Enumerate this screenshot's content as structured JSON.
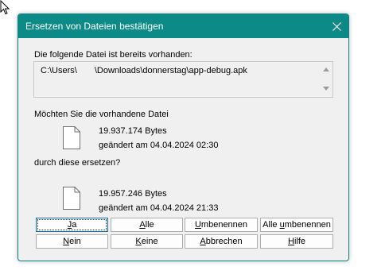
{
  "dialog": {
    "title": "Ersetzen von Dateien bestätigen",
    "info_label": "Die folgende Datei ist bereits vorhanden:",
    "path_prefix": "C:\\Users\\",
    "path_suffix": "\\Downloads\\donnerstag\\app-debug.apk",
    "existing_question": "Möchten Sie die vorhandene Datei",
    "existing_file": {
      "size": "19.937.174 Bytes",
      "changed": "geändert am 04.04.2024 02:30"
    },
    "replace_question": "durch diese ersetzen?",
    "new_file": {
      "size": "19.957.246 Bytes",
      "changed": "geändert am 04.04.2024 21:33"
    }
  },
  "buttons": {
    "ja": {
      "mnemonic": "J",
      "rest": "a"
    },
    "alle": {
      "mnemonic": "A",
      "rest": "lle"
    },
    "umbenennen": {
      "mnemonic": "U",
      "rest": "mbenennen"
    },
    "alle_umbenennen": {
      "before": "Alle ",
      "mnemonic": "u",
      "rest": "mbenennen"
    },
    "nein": {
      "mnemonic": "N",
      "rest": "ein"
    },
    "keine": {
      "mnemonic": "K",
      "rest": "eine"
    },
    "abbrechen": {
      "mnemonic": "A",
      "rest": "bbrechen"
    },
    "hilfe": {
      "mnemonic": "H",
      "rest": "ilfe"
    }
  },
  "icons": {
    "close": "close-icon",
    "file": "file-icon",
    "scroll_up": "scroll-up-arrow-icon",
    "scroll_down": "scroll-down-arrow-icon"
  },
  "colors": {
    "titlebar": "#0c8a87",
    "dialog_bg": "#f0f0f0",
    "default_button_border": "#0c6fb8"
  }
}
